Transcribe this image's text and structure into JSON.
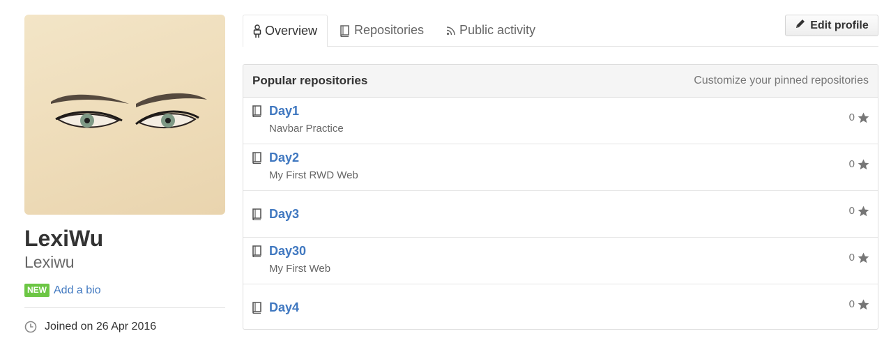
{
  "profile": {
    "full_name": "LexiWu",
    "username": "Lexiwu",
    "new_badge": "NEW",
    "add_bio": "Add a bio",
    "joined": "Joined on 26 Apr 2016"
  },
  "tabs": [
    {
      "label": "Overview",
      "icon": "person-icon",
      "selected": true
    },
    {
      "label": "Repositories",
      "icon": "book-icon",
      "selected": false
    },
    {
      "label": "Public activity",
      "icon": "rss-icon",
      "selected": false
    }
  ],
  "edit_profile_label": "Edit profile",
  "popular": {
    "title": "Popular repositories",
    "customize": "Customize your pinned repositories",
    "repos": [
      {
        "name": "Day1",
        "description": "Navbar Practice",
        "stars": "0"
      },
      {
        "name": "Day2",
        "description": "My First RWD Web",
        "stars": "0"
      },
      {
        "name": "Day3",
        "description": "",
        "stars": "0"
      },
      {
        "name": "Day30",
        "description": "My First Web",
        "stars": "0"
      },
      {
        "name": "Day4",
        "description": "",
        "stars": "0"
      }
    ]
  },
  "colors": {
    "link": "#4078c0",
    "new_badge": "#6cc644",
    "avatar_bg": "#eedcb9"
  }
}
